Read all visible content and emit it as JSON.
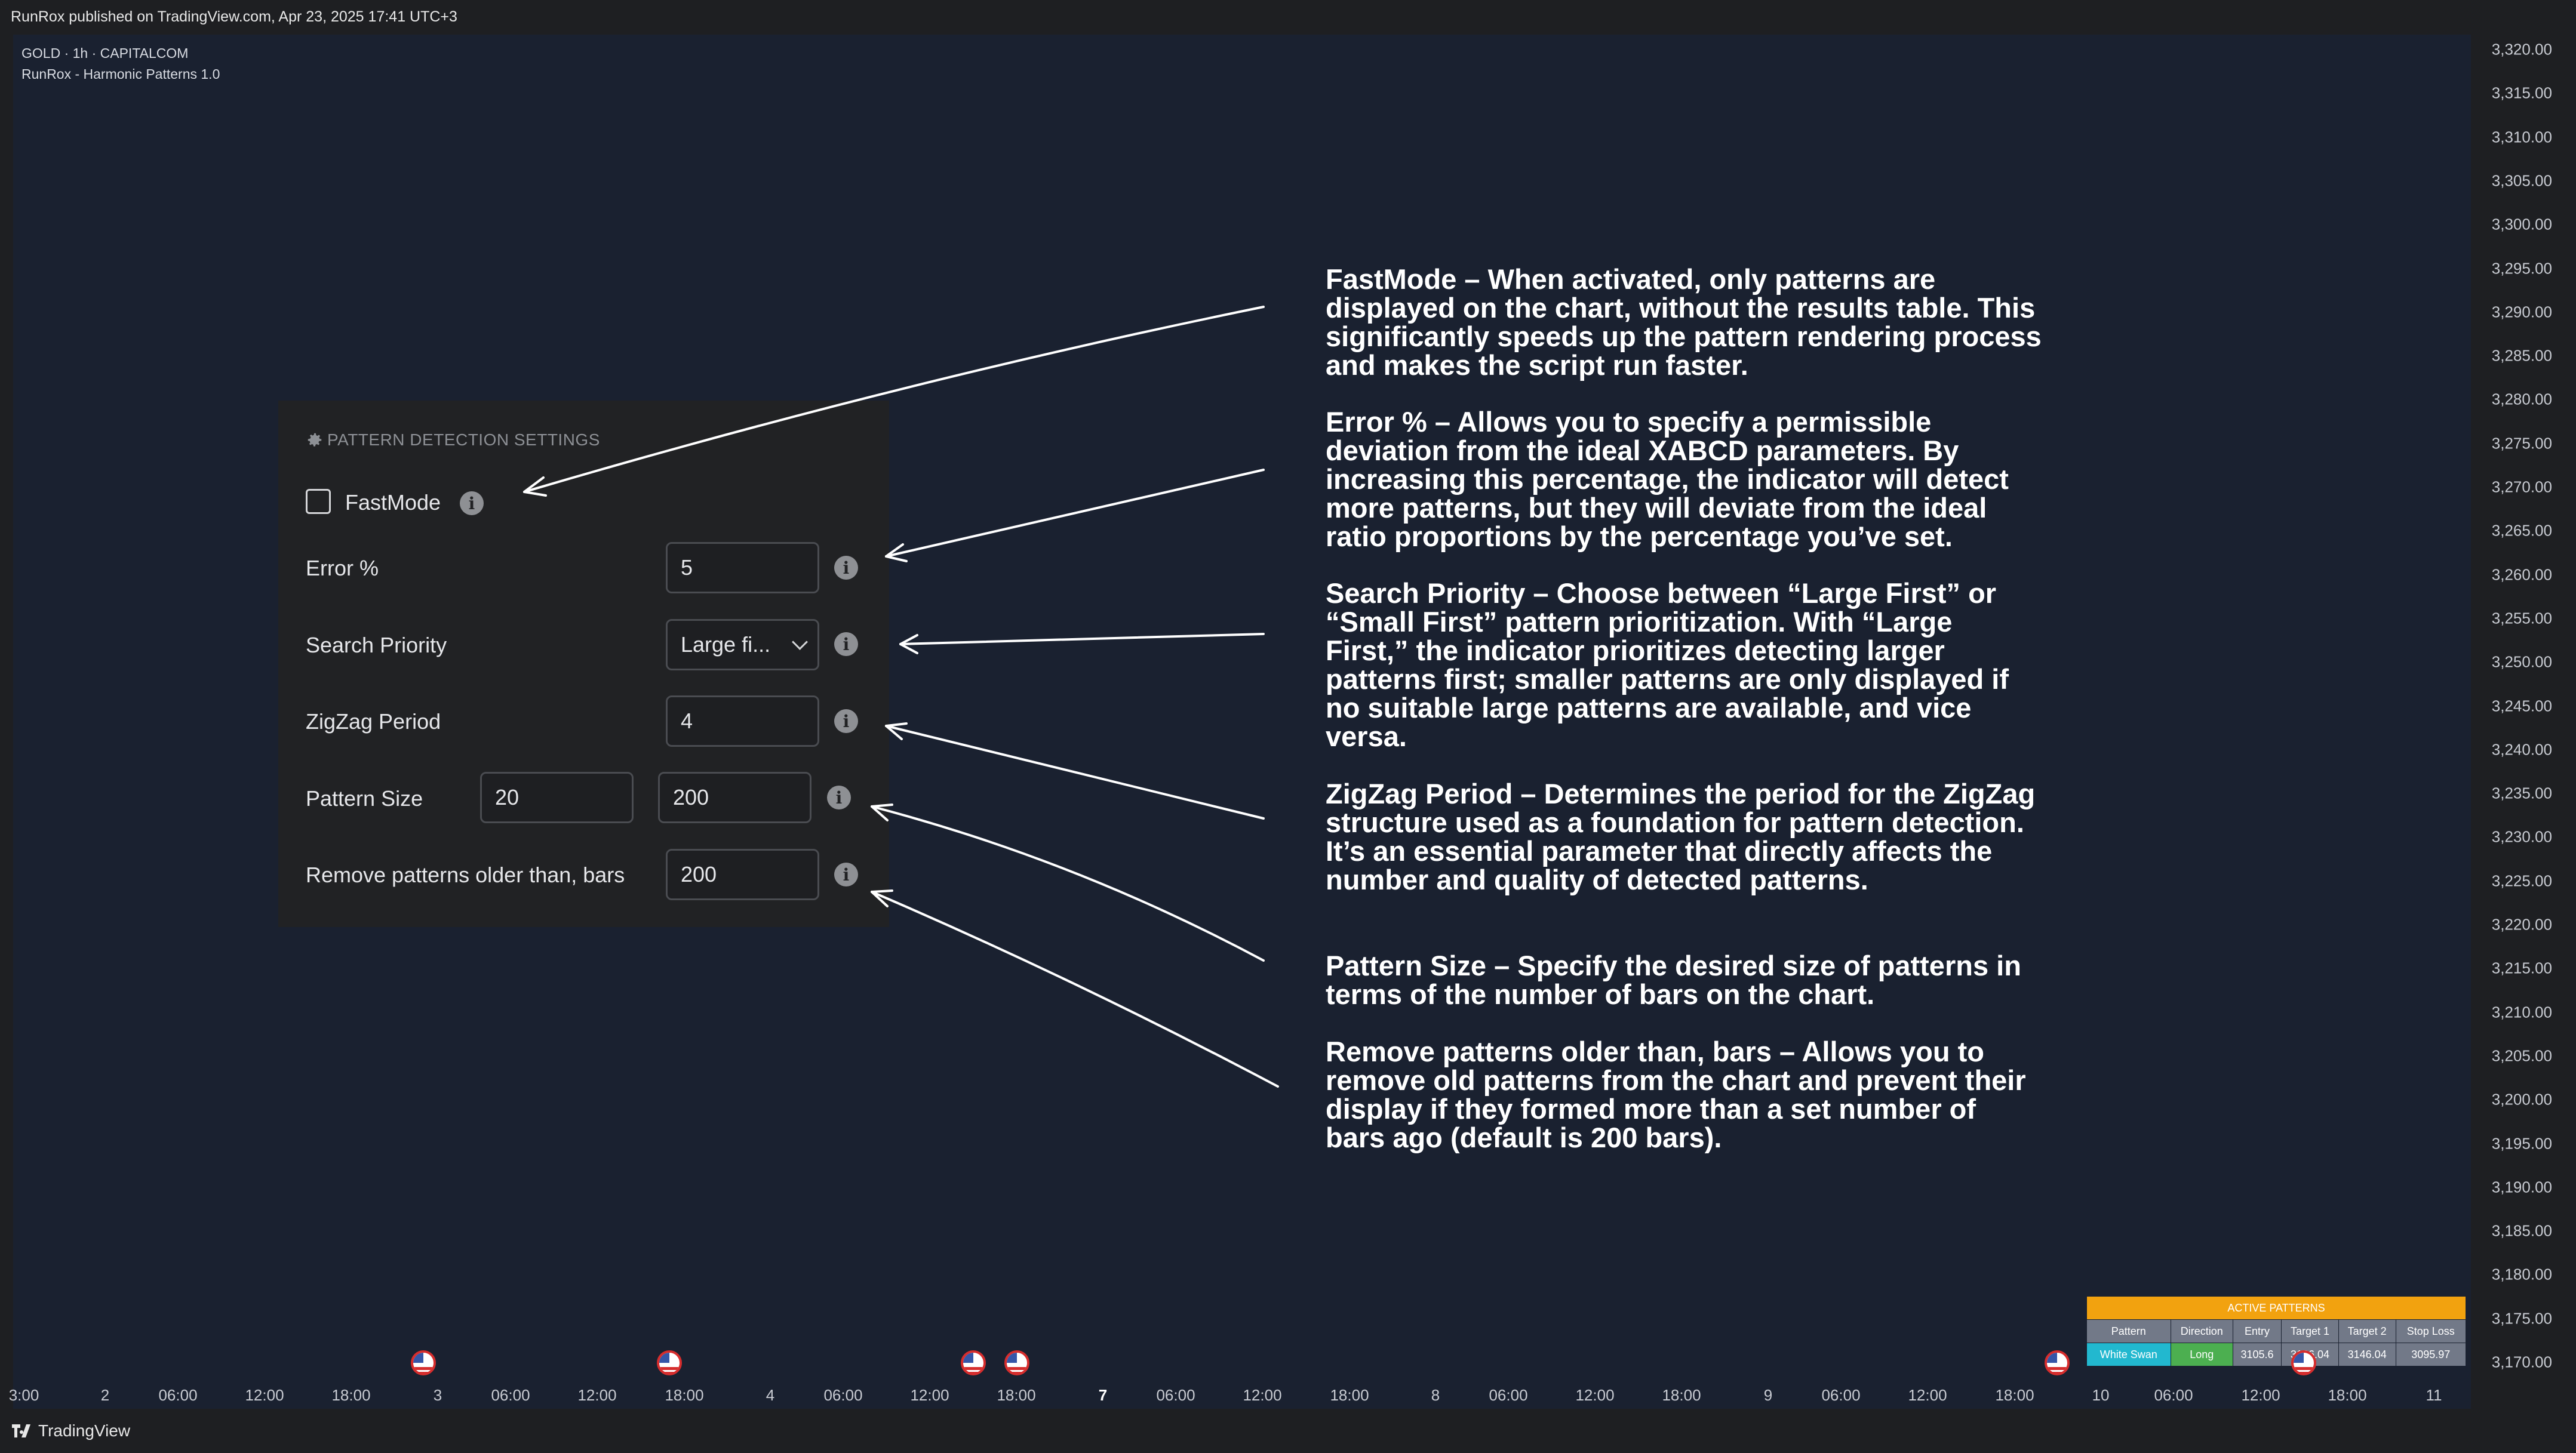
{
  "header": {
    "published": "RunRox published on TradingView.com, Apr 23, 2025 17:41 UTC+3"
  },
  "chart_info": {
    "symbol": "GOLD · 1h · CAPITALCOM",
    "indicator": "RunRox - Harmonic Patterns 1.0"
  },
  "price_axis": [
    "3,320.00",
    "3,315.00",
    "3,310.00",
    "3,305.00",
    "3,300.00",
    "3,295.00",
    "3,290.00",
    "3,285.00",
    "3,280.00",
    "3,275.00",
    "3,270.00",
    "3,265.00",
    "3,260.00",
    "3,255.00",
    "3,250.00",
    "3,245.00",
    "3,240.00",
    "3,235.00",
    "3,230.00",
    "3,225.00",
    "3,220.00",
    "3,215.00",
    "3,210.00",
    "3,205.00",
    "3,200.00",
    "3,195.00",
    "3,190.00",
    "3,185.00",
    "3,180.00",
    "3,175.00",
    "3,170.00"
  ],
  "time_axis": [
    "3:00",
    "2",
    "06:00",
    "12:00",
    "18:00",
    "3",
    "06:00",
    "12:00",
    "18:00",
    "4",
    "06:00",
    "12:00",
    "18:00",
    "7",
    "06:00",
    "12:00",
    "18:00",
    "8",
    "06:00",
    "12:00",
    "18:00",
    "9",
    "06:00",
    "12:00",
    "18:00",
    "10",
    "06:00",
    "12:00",
    "18:00",
    "11"
  ],
  "settings_panel": {
    "title": "PATTERN DETECTION SETTINGS",
    "fastmode_label": "FastMode",
    "error_label": "Error %",
    "error_value": "5",
    "priority_label": "Search Priority",
    "priority_value": "Large fi...",
    "zigzag_label": "ZigZag Period",
    "zigzag_value": "4",
    "size_label": "Pattern Size",
    "size_min": "20",
    "size_max": "200",
    "remove_label": "Remove patterns older than, bars",
    "remove_value": "200",
    "info_glyph": "i"
  },
  "descriptions": {
    "fastmode": "FastMode – When activated, only patterns are displayed on the chart, without the results table. This significantly speeds up the pattern rendering process and makes the script run faster.",
    "error": "Error % – Allows you to specify a permissible deviation from the ideal XABCD parameters. By increasing this percentage, the indicator will detect more patterns, but they will deviate from the ideal ratio proportions by the percentage you’ve set.",
    "priority": "Search Priority – Choose between “Large First” or “Small First” pattern prioritization. With “Large First,” the indicator prioritizes detecting larger patterns first; smaller patterns are only displayed if no suitable large patterns are available, and vice versa.",
    "zigzag": "ZigZag Period – Determines the period for the ZigZag structure used as a foundation for pattern detection. It’s an essential parameter that directly affects the number and quality of detected patterns.",
    "size": "Pattern Size – Specify the desired size of patterns in terms of the number of bars on the chart.",
    "remove": "Remove patterns older than, bars – Allows you to remove old patterns from the chart and prevent their display if they formed more than a set number of bars ago (default is 200 bars)."
  },
  "active_patterns": {
    "title": "ACTIVE PATTERNS",
    "headers": [
      "Pattern",
      "Direction",
      "Entry",
      "Target 1",
      "Target 2",
      "Stop Loss"
    ],
    "row": [
      "White Swan",
      "Long",
      "3105.6",
      "3126.04",
      "3146.04",
      "3095.97"
    ],
    "colors": {
      "title": "#f2a20f",
      "pattern": "#22b8cf",
      "direction": "#4caf50",
      "cell": "#727988"
    }
  },
  "footer": {
    "brand": "TradingView"
  },
  "icons": [
    "gear-icon",
    "info-icon",
    "chevron-down-icon",
    "us-flag-icon",
    "tradingview-logo-icon",
    "checkbox-unchecked-icon"
  ]
}
